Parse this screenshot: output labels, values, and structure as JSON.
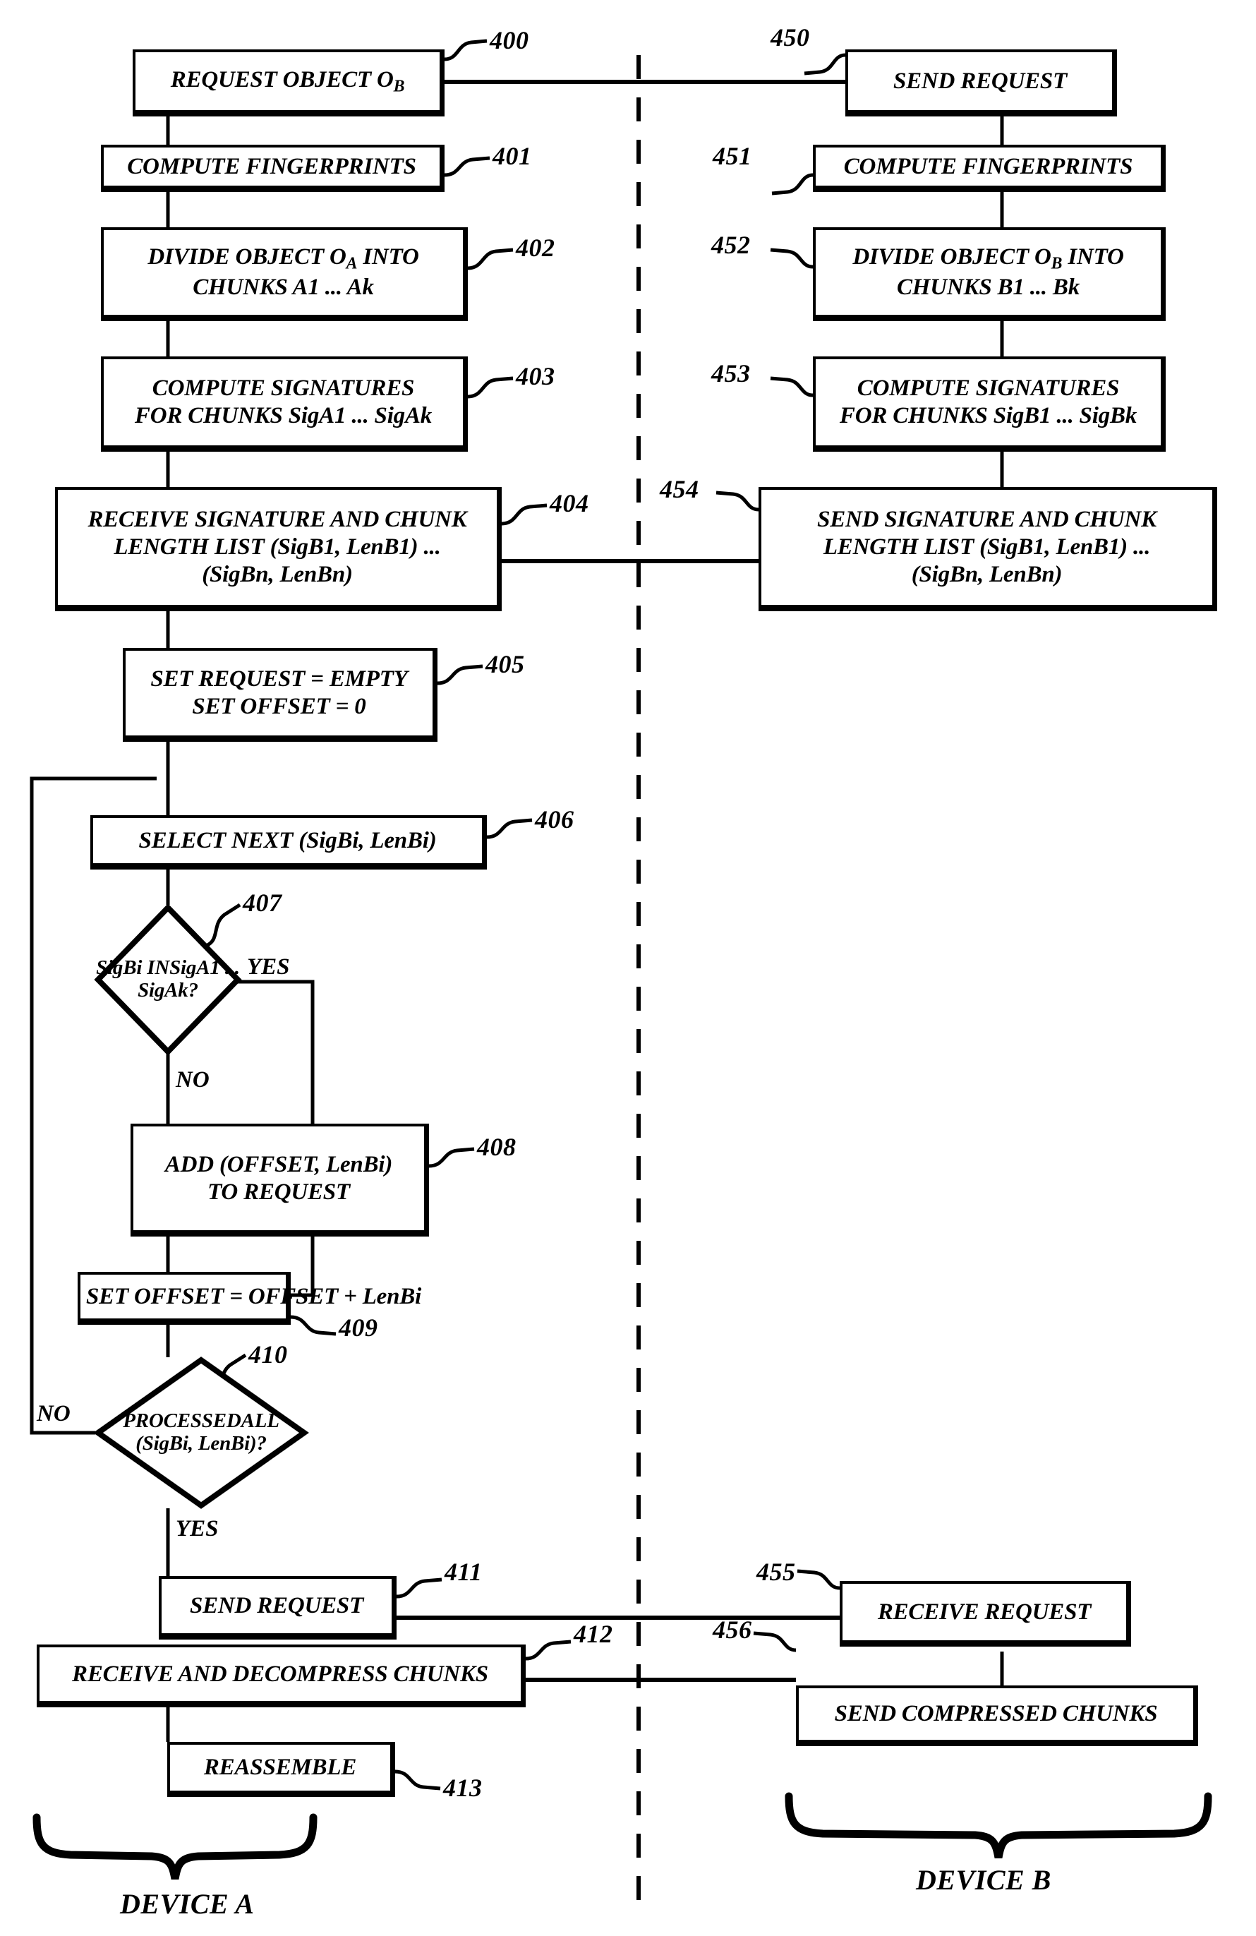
{
  "figure": {
    "type": "patent-flowchart",
    "divider": "vertical dashed line separating Device A and Device B"
  },
  "device_a": {
    "label": "DEVICE A",
    "nodes": [
      {
        "ref": "400",
        "shape": "process",
        "lines": [
          "REQUEST OBJECT O<sub>B</sub>"
        ]
      },
      {
        "ref": "401",
        "shape": "process",
        "lines": [
          "COMPUTE FINGERPRINTS"
        ]
      },
      {
        "ref": "402",
        "shape": "process",
        "lines": [
          "DIVIDE OBJECT O<sub>A</sub> INTO",
          "CHUNKS A1 ... Ak"
        ]
      },
      {
        "ref": "403",
        "shape": "process",
        "lines": [
          "COMPUTE SIGNATURES",
          "FOR CHUNKS SigA1 ... SigAk"
        ]
      },
      {
        "ref": "404",
        "shape": "process",
        "lines": [
          "RECEIVE SIGNATURE AND CHUNK",
          "LENGTH LIST (SigB1, LenB1) ...",
          "(SigBn, LenBn)"
        ]
      },
      {
        "ref": "405",
        "shape": "process",
        "lines": [
          "SET REQUEST = EMPTY",
          "SET OFFSET = 0"
        ]
      },
      {
        "ref": "406",
        "shape": "process",
        "lines": [
          "SELECT NEXT (SigBi, LenBi)"
        ]
      },
      {
        "ref": "407",
        "shape": "decision",
        "lines": [
          "SigBi IN",
          "SigA1 ... SigAk",
          "?"
        ],
        "yes": "YES",
        "no": "NO"
      },
      {
        "ref": "408",
        "shape": "process",
        "lines": [
          "ADD (OFFSET, LenBi)",
          "TO REQUEST"
        ]
      },
      {
        "ref": "409",
        "shape": "process",
        "lines": [
          "SET OFFSET = OFFSET + LenBi"
        ]
      },
      {
        "ref": "410",
        "shape": "decision",
        "lines": [
          "PROCESSED",
          "ALL (SigBi, LenBi)",
          "?"
        ],
        "yes": "YES",
        "no": "NO"
      },
      {
        "ref": "411",
        "shape": "process",
        "lines": [
          "SEND REQUEST"
        ]
      },
      {
        "ref": "412",
        "shape": "process",
        "lines": [
          "RECEIVE AND DECOMPRESS CHUNKS"
        ]
      },
      {
        "ref": "413",
        "shape": "process",
        "lines": [
          "REASSEMBLE"
        ]
      }
    ]
  },
  "device_b": {
    "label": "DEVICE B",
    "nodes": [
      {
        "ref": "450",
        "shape": "process",
        "lines": [
          "SEND REQUEST"
        ]
      },
      {
        "ref": "451",
        "shape": "process",
        "lines": [
          "COMPUTE FINGERPRINTS"
        ]
      },
      {
        "ref": "452",
        "shape": "process",
        "lines": [
          "DIVIDE OBJECT O<sub>B</sub> INTO",
          "CHUNKS B1 ... Bk"
        ]
      },
      {
        "ref": "453",
        "shape": "process",
        "lines": [
          "COMPUTE SIGNATURES",
          "FOR CHUNKS SigB1 ... SigBk"
        ]
      },
      {
        "ref": "454",
        "shape": "process",
        "lines": [
          "SEND SIGNATURE AND CHUNK",
          "LENGTH LIST (SigB1, LenB1) ...",
          "(SigBn, LenBn)"
        ]
      },
      {
        "ref": "455",
        "shape": "process",
        "lines": [
          "RECEIVE REQUEST"
        ]
      },
      {
        "ref": "456",
        "shape": "process",
        "lines": [
          "SEND COMPRESSED CHUNKS"
        ]
      }
    ]
  },
  "branch_labels": {
    "yes_407": "YES",
    "no_407": "NO",
    "no_410": "NO",
    "yes_410": "YES"
  },
  "colors": {
    "ink": "#000000",
    "paper": "#ffffff"
  }
}
